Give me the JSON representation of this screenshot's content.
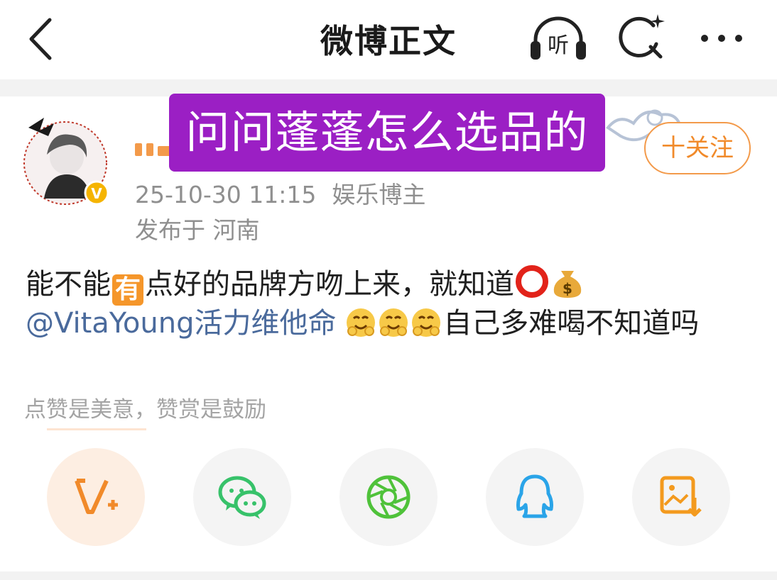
{
  "header": {
    "title": "微博正文",
    "listen_label": "听"
  },
  "overlay": {
    "caption": "问问蓬蓬怎么选品的"
  },
  "author": {
    "follow_label": "十关注",
    "timestamp": "25-10-30 11:15",
    "category": "娱乐博主",
    "location": "发布于 河南",
    "verified_badge": "V"
  },
  "post": {
    "line1_part1": "能不能",
    "you_chip": "有",
    "line1_part2": "点好的品牌方吻上来，就知道",
    "mention": "@VitaYoung活力维他命",
    "line2_tail": "自己多难喝不知道吗",
    "emoji_1": "red-circle",
    "emoji_2": "money-bag",
    "emoji_3": "smirk-face-x3"
  },
  "reward_hint": "点赞是美意，赞赏是鼓励",
  "share": {
    "items": [
      "v-plus",
      "wechat",
      "moments",
      "qq",
      "save-image"
    ]
  },
  "colors": {
    "overlay_bg": "#9b1fc4",
    "accent_orange": "#f18a2a",
    "mention_blue": "#4a6a9c",
    "wechat_green": "#37c26a",
    "moments_green": "#4fc23a",
    "qq_blue": "#2aa4e8",
    "save_orange": "#f39a1e"
  }
}
